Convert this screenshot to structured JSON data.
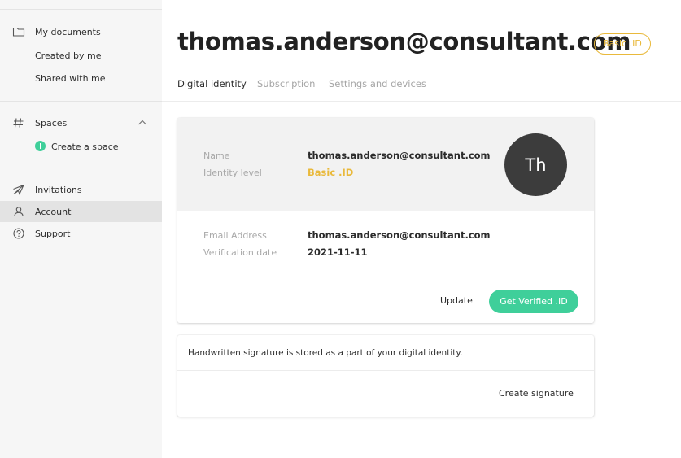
{
  "sidebar": {
    "my_documents": "My documents",
    "created_by_me": "Created by me",
    "shared_with_me": "Shared with me",
    "spaces": "Spaces",
    "create_space": "Create a space",
    "invitations": "Invitations",
    "account": "Account",
    "support": "Support",
    "active_item": "Account"
  },
  "header": {
    "title": "thomas.anderson@consultant.com",
    "badge": "Basic .ID",
    "tabs": [
      {
        "label": "Digital identity",
        "active": true
      },
      {
        "label": "Subscription",
        "active": false
      },
      {
        "label": "Settings and devices",
        "active": false
      }
    ]
  },
  "identity": {
    "name_label": "Name",
    "name_value": "thomas.anderson@consultant.com",
    "level_label": "Identity level",
    "level_value": "Basic .ID",
    "avatar_initials": "Th",
    "email_label": "Email Address",
    "email_value": "thomas.anderson@consultant.com",
    "verification_label": "Verification date",
    "verification_value": "2021-11-11",
    "update_label": "Update",
    "get_verified_label": "Get Verified .ID"
  },
  "signature": {
    "text": "Handwritten signature is stored as a part of your digital identity.",
    "create_label": "Create signature"
  },
  "colors": {
    "accent_green": "#3fcf9a",
    "badge_gold": "#e9b93b",
    "avatar_bg": "#3c3c3c"
  }
}
